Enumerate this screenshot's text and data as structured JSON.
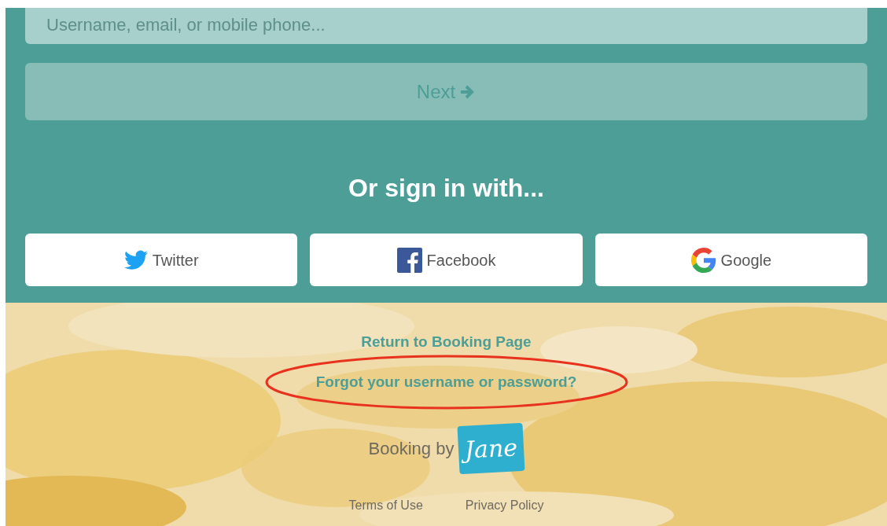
{
  "login": {
    "username_field": {
      "placeholder": "Username, email, or mobile phone..."
    },
    "next_button": {
      "label": "Next",
      "disabled": true
    }
  },
  "social": {
    "heading": "Or sign in with...",
    "buttons": [
      {
        "kind": "twitter",
        "label": "Twitter"
      },
      {
        "kind": "facebook",
        "label": "Facebook"
      },
      {
        "kind": "google",
        "label": "Google"
      }
    ]
  },
  "footer": {
    "links": [
      {
        "label": "Return to Booking Page",
        "highlighted": false
      },
      {
        "label": "Forgot your username or password?",
        "highlighted": true
      }
    ],
    "branding": {
      "text": "Booking by",
      "logo_text": "Jane"
    },
    "legal_links": [
      "Terms of Use",
      "Privacy Policy"
    ]
  }
}
